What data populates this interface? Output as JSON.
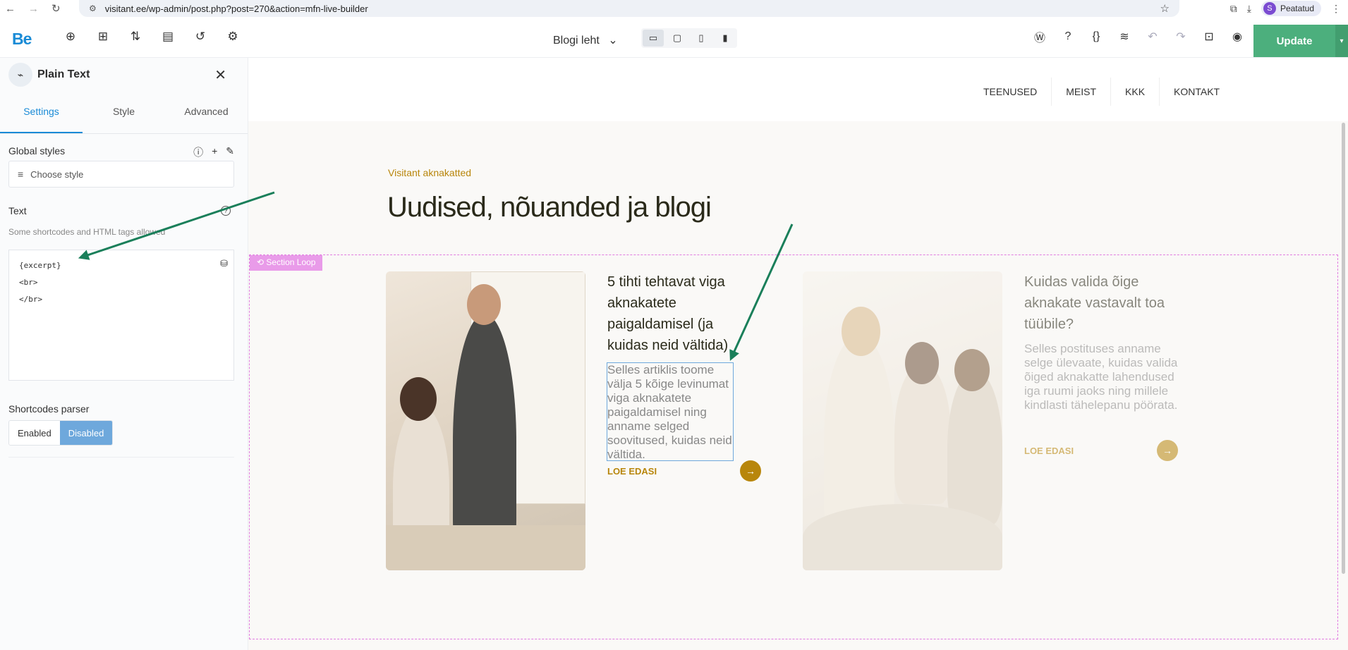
{
  "browser": {
    "url": "visitant.ee/wp-admin/post.php?post=270&action=mfn-live-builder",
    "profile_initial": "S",
    "profile_label": "Peatatud"
  },
  "toolbar": {
    "logo": "Be",
    "page_selector": "Blogi leht",
    "update_label": "Update"
  },
  "panel": {
    "title": "Plain Text",
    "tabs": [
      {
        "label": "Settings",
        "active": true
      },
      {
        "label": "Style",
        "active": false
      },
      {
        "label": "Advanced",
        "active": false
      }
    ],
    "global_styles_label": "Global styles",
    "choose_style_placeholder": "Choose style",
    "text_label": "Text",
    "text_hint": "Some shortcodes and HTML tags allowed",
    "text_lines": [
      "{excerpt}",
      "<br>",
      "</br>"
    ],
    "shortcodes_label": "Shortcodes parser",
    "shortcodes_options": [
      "Enabled",
      "Disabled"
    ],
    "shortcodes_selected": "Disabled"
  },
  "site": {
    "menu": [
      "TEENUSED",
      "MEIST",
      "KKK",
      "KONTAKT"
    ],
    "eyebrow": "Visitant aknakatted",
    "heading": "Uudised, nõuanded ja blogi",
    "loop_tag": "Section Loop",
    "cards": [
      {
        "title": "5 tihti tehtavat viga aknakatete paigaldamisel (ja kuidas neid vältida)",
        "excerpt": "Selles artiklis toome välja 5 kõige levinumat viga aknakatete paigaldamisel ning anname selged soovitused, kuidas neid vältida.",
        "more": "LOE EDASI"
      },
      {
        "title": "Kuidas valida õige aknakate vastavalt toa tüübile?",
        "excerpt": "Selles postituses anname selge ülevaate, kuidas valida õiged aknakatte lahendused iga ruumi jaoks ning millele kindlasti tähelepanu pöörata.",
        "more": "LOE EDASI"
      }
    ]
  },
  "colors": {
    "accent": "#b8860b",
    "builder_blue": "#1a8bd6",
    "update_green": "#4caf7d",
    "loop_border": "#e07ce0",
    "annotation_arrow": "#1a7f5a"
  }
}
